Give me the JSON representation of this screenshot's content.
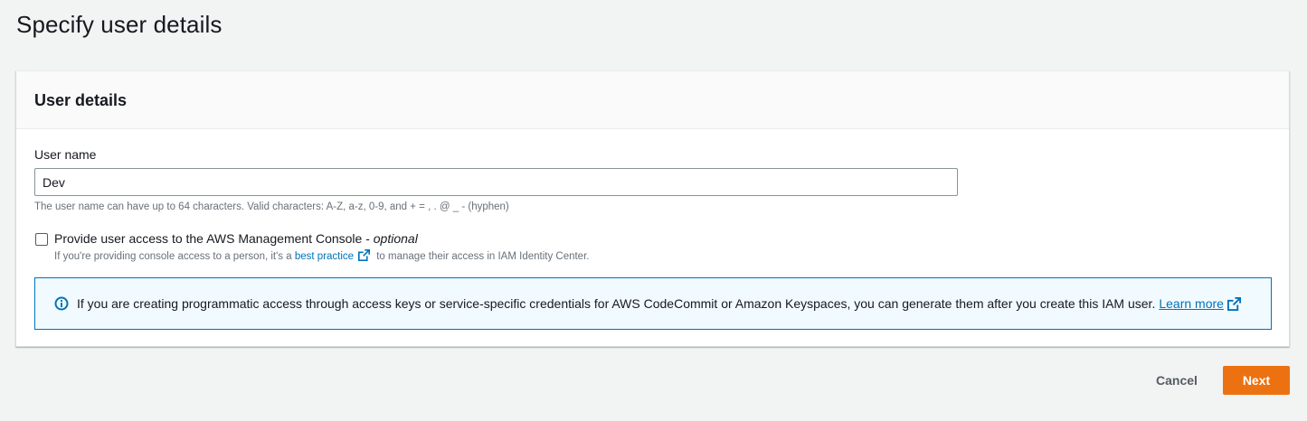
{
  "page": {
    "title": "Specify user details"
  },
  "user_details": {
    "header": "User details",
    "user_name": {
      "label": "User name",
      "value": "Dev",
      "hint": "The user name can have up to 64 characters. Valid characters: A-Z, a-z, 0-9, and + = , . @ _ - (hyphen)"
    },
    "console_access": {
      "label": "Provide user access to the AWS Management Console - ",
      "optional": "optional",
      "checked": false,
      "desc_prefix": "If you're providing console access to a person, it's a ",
      "desc_link": "best practice",
      "desc_suffix": " to manage their access in IAM Identity Center."
    },
    "info_alert": {
      "text": "If you are creating programmatic access through access keys or service-specific credentials for AWS CodeCommit or Amazon Keyspaces, you can generate them after you create this IAM user.",
      "link": "Learn more"
    }
  },
  "actions": {
    "cancel": "Cancel",
    "next": "Next"
  },
  "icons": {
    "info": "info-icon",
    "external": "external-link-icon"
  },
  "colors": {
    "accent": "#ec7211",
    "link": "#0073bb",
    "info_bg": "#f1faff"
  }
}
